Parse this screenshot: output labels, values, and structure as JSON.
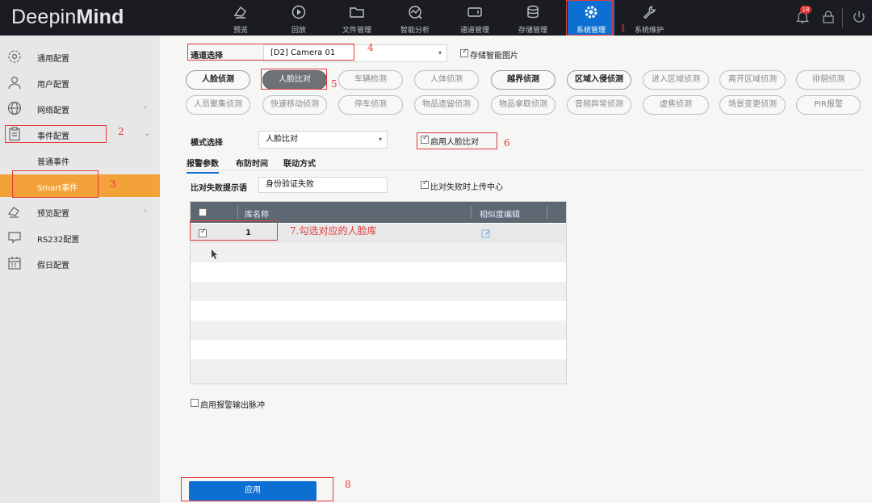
{
  "app": {
    "logo_light": "Deepin",
    "logo_bold": "Mind"
  },
  "topnav": [
    {
      "label": "预览",
      "icon": "preview-icon"
    },
    {
      "label": "回放",
      "icon": "playback-icon"
    },
    {
      "label": "文件管理",
      "icon": "folder-icon"
    },
    {
      "label": "智能分析",
      "icon": "analytics-icon"
    },
    {
      "label": "通道管理",
      "icon": "channel-icon"
    },
    {
      "label": "存储管理",
      "icon": "storage-icon"
    },
    {
      "label": "系统管理",
      "icon": "gear-icon",
      "active": true
    },
    {
      "label": "系统维护",
      "icon": "wrench-icon"
    }
  ],
  "alerts": {
    "count": "18"
  },
  "sidebar": {
    "items": [
      {
        "label": "通用配置",
        "icon": "gear-outline-icon"
      },
      {
        "label": "用户配置",
        "icon": "user-icon"
      },
      {
        "label": "网络配置",
        "icon": "globe-icon",
        "chevron": "›"
      },
      {
        "label": "事件配置",
        "icon": "clipboard-icon",
        "chevron": "⌄"
      },
      {
        "label": "预览配置",
        "icon": "camera-icon",
        "chevron": "›"
      },
      {
        "label": "RS232配置",
        "icon": "chat-icon"
      },
      {
        "label": "假日配置",
        "icon": "calendar-icon"
      }
    ],
    "subitems": [
      {
        "label": "普通事件"
      },
      {
        "label": "Smart事件",
        "active": true
      }
    ]
  },
  "channel": {
    "label": "通道选择",
    "value": "[D2] Camera 01",
    "arrow": "▾"
  },
  "save_smart_image": {
    "label": "存储智能图片",
    "checked": true
  },
  "smart_buttons": [
    {
      "label": "人脸侦测",
      "style": "bold"
    },
    {
      "label": "人脸比对",
      "style": "active"
    },
    {
      "label": "车辆检测"
    },
    {
      "label": "人体侦测"
    },
    {
      "label": "越界侦测",
      "style": "bold"
    },
    {
      "label": "区域入侵侦测",
      "style": "bold"
    },
    {
      "label": "进入区域侦测"
    },
    {
      "label": "离开区域侦测"
    },
    {
      "label": "徘徊侦测"
    },
    {
      "label": "人员聚集侦测"
    },
    {
      "label": "快速移动侦测"
    },
    {
      "label": "停车侦测"
    },
    {
      "label": "物品遗留侦测"
    },
    {
      "label": "物品拿取侦测"
    },
    {
      "label": "音频异常侦测"
    },
    {
      "label": "虚焦侦测"
    },
    {
      "label": "场景变更侦测"
    },
    {
      "label": "PIR报警"
    }
  ],
  "mode": {
    "label": "模式选择",
    "value": "人脸比对",
    "arrow": "▾"
  },
  "enable_face_compare": {
    "label": "启用人脸比对",
    "checked": true
  },
  "tabs": [
    {
      "label": "报警参数",
      "active": true
    },
    {
      "label": "布防时间"
    },
    {
      "label": "联动方式"
    }
  ],
  "fail_prompt": {
    "label": "比对失败提示语",
    "value": "身份验证失败"
  },
  "upload_on_fail": {
    "label": "比对失败时上传中心",
    "checked": true
  },
  "table": {
    "columns": [
      "库名称",
      "相似度编辑"
    ],
    "rows": [
      {
        "name": "1",
        "checked": true,
        "edit_icon": "edit-icon"
      }
    ]
  },
  "alarm_pulse": {
    "label": "启用报警输出脉冲",
    "checked": false
  },
  "apply_label": "应用",
  "annotations": [
    {
      "num": "1"
    },
    {
      "num": "2"
    },
    {
      "num": "3"
    },
    {
      "num": "4"
    },
    {
      "num": "5"
    },
    {
      "num": "6"
    },
    {
      "text": "7.勾选对应的人脸库"
    },
    {
      "num": "8"
    }
  ],
  "colors": {
    "accent": "#0d6fd1",
    "active_sidebar": "#f3a23a",
    "annotation": "#e23a3a",
    "topbar": "#1a1c22"
  }
}
